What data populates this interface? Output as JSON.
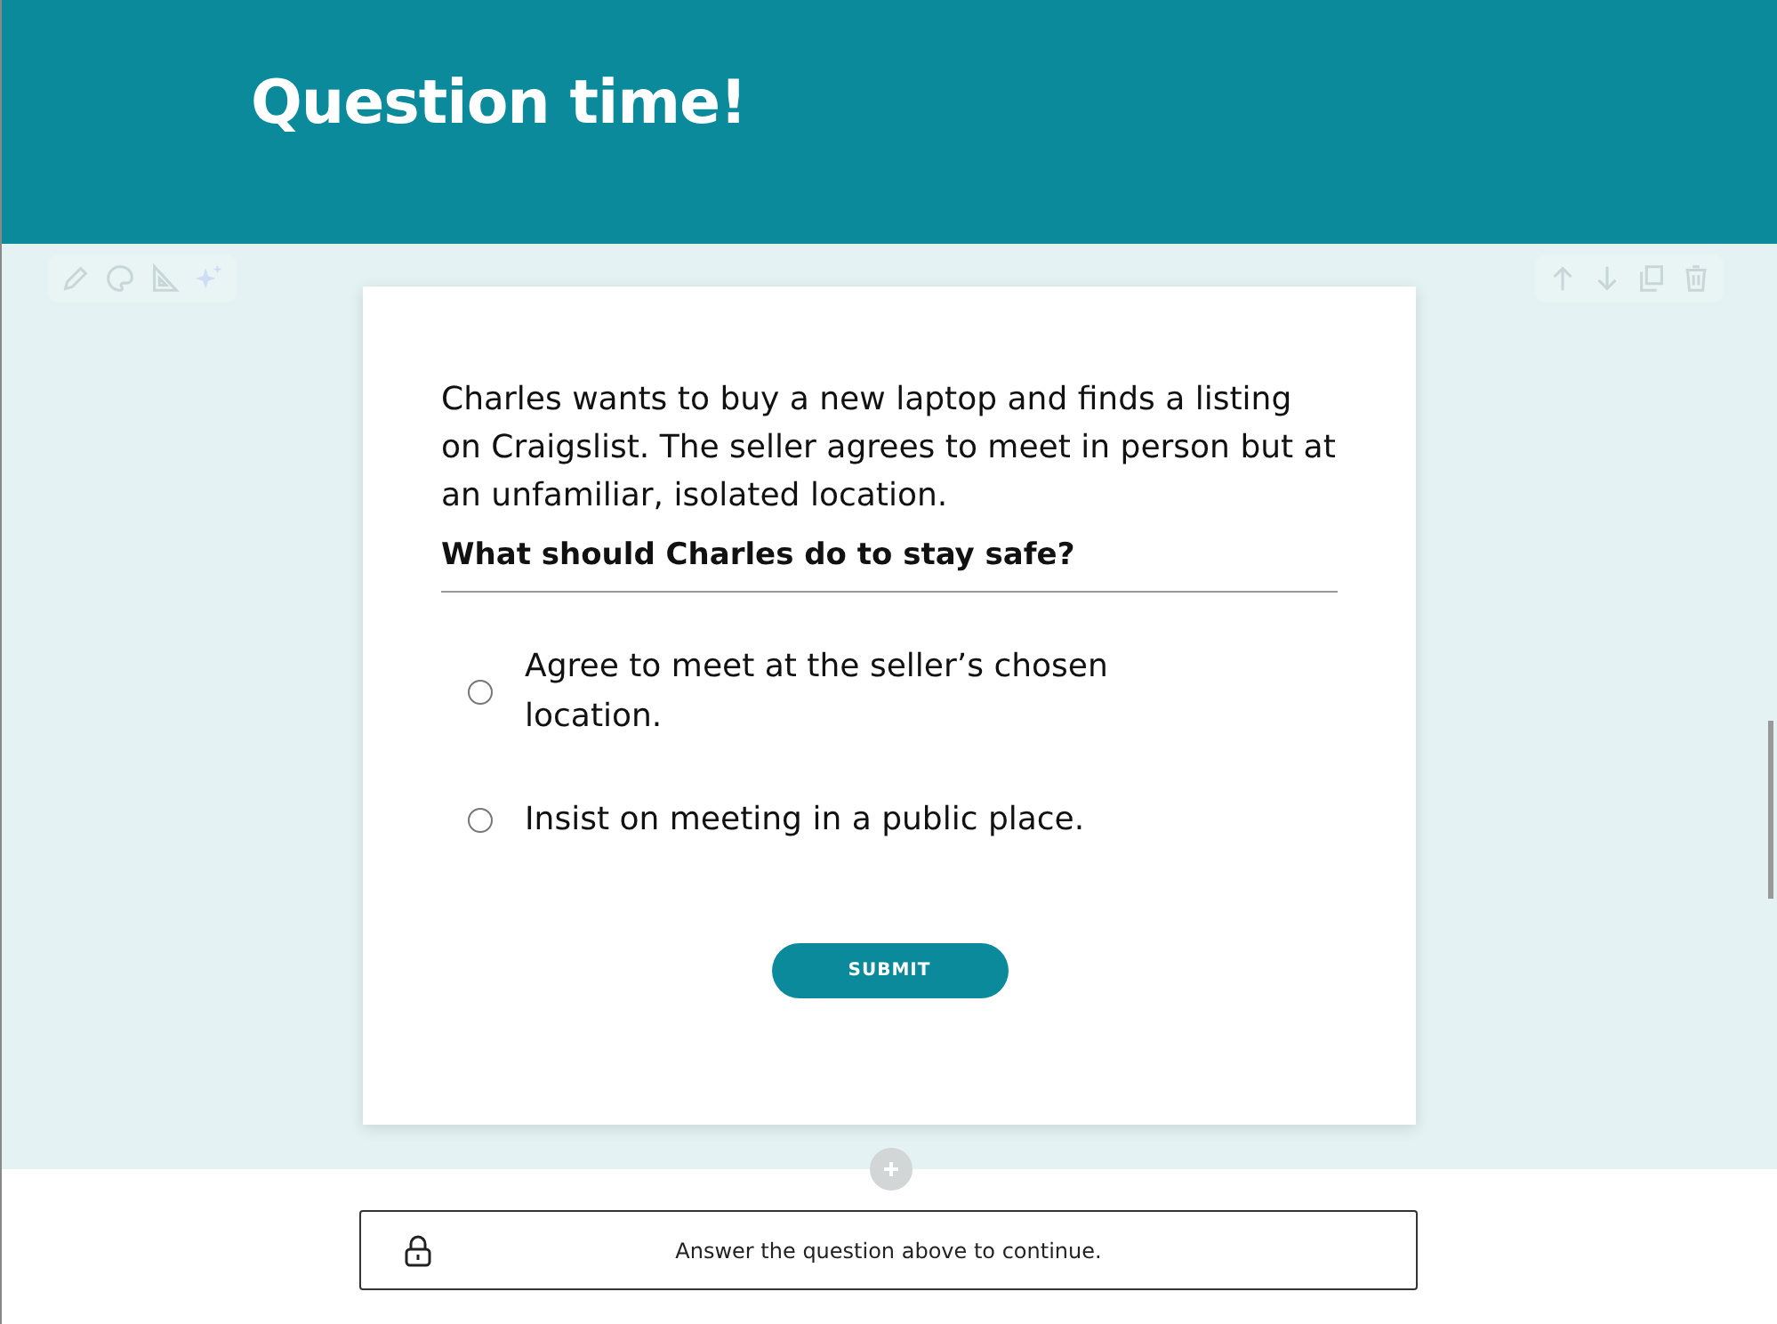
{
  "header": {
    "title": "Question time!"
  },
  "question": {
    "scenario": "Charles wants to buy a new laptop and finds a listing on Craigslist. The seller agrees to meet in person but at an unfamiliar, isolated location.",
    "prompt": "What should Charles do to stay safe?",
    "options": [
      {
        "label": "Agree to meet at the seller’s chosen location.",
        "selected": false
      },
      {
        "label": "Insist on meeting in a public place.",
        "selected": false
      }
    ],
    "submit": "SUBMIT"
  },
  "locked_notice": {
    "text": "Answer the question above to continue."
  }
}
